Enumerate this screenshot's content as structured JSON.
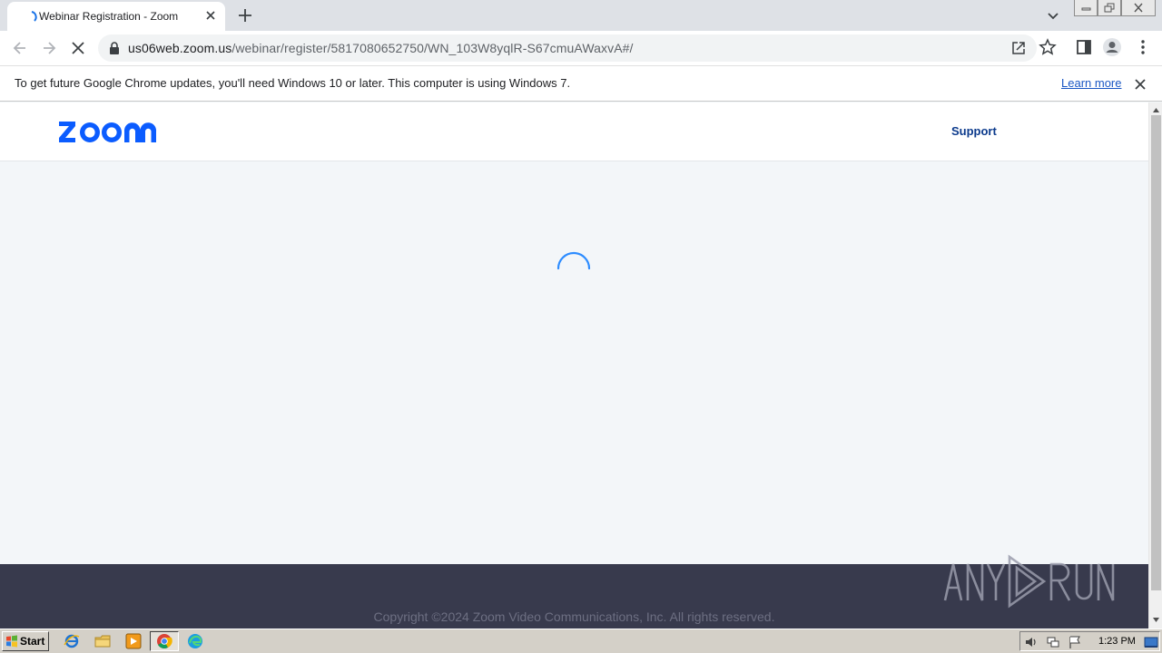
{
  "browser": {
    "tab_title": "Webinar Registration - Zoom",
    "url_host": "us06web.zoom.us",
    "url_path": "/webinar/register/5817080652750/WN_103W8yqlR-S67cmuAWaxvA#/"
  },
  "infobar": {
    "message": "To get future Google Chrome updates, you'll need Windows 10 or later. This computer is using Windows 7.",
    "learn_more": "Learn more"
  },
  "page": {
    "nav_support": "Support",
    "copyright": "Copyright ©2024 Zoom Video Communications, Inc. All rights reserved."
  },
  "taskbar": {
    "start_label": "Start",
    "clock": "1:23 PM"
  },
  "icons": {
    "tab_loading": "loading-spinner-icon",
    "page_loading": "loading-spinner-icon",
    "logo": "zoom-logo",
    "watermark": "anyrun-watermark"
  },
  "colors": {
    "zoom_blue": "#0b5cff",
    "support_link": "#0b3a8c",
    "footer_bg": "#383a4d",
    "page_bg": "#f3f6f9",
    "spinner": "#2d8cff"
  }
}
